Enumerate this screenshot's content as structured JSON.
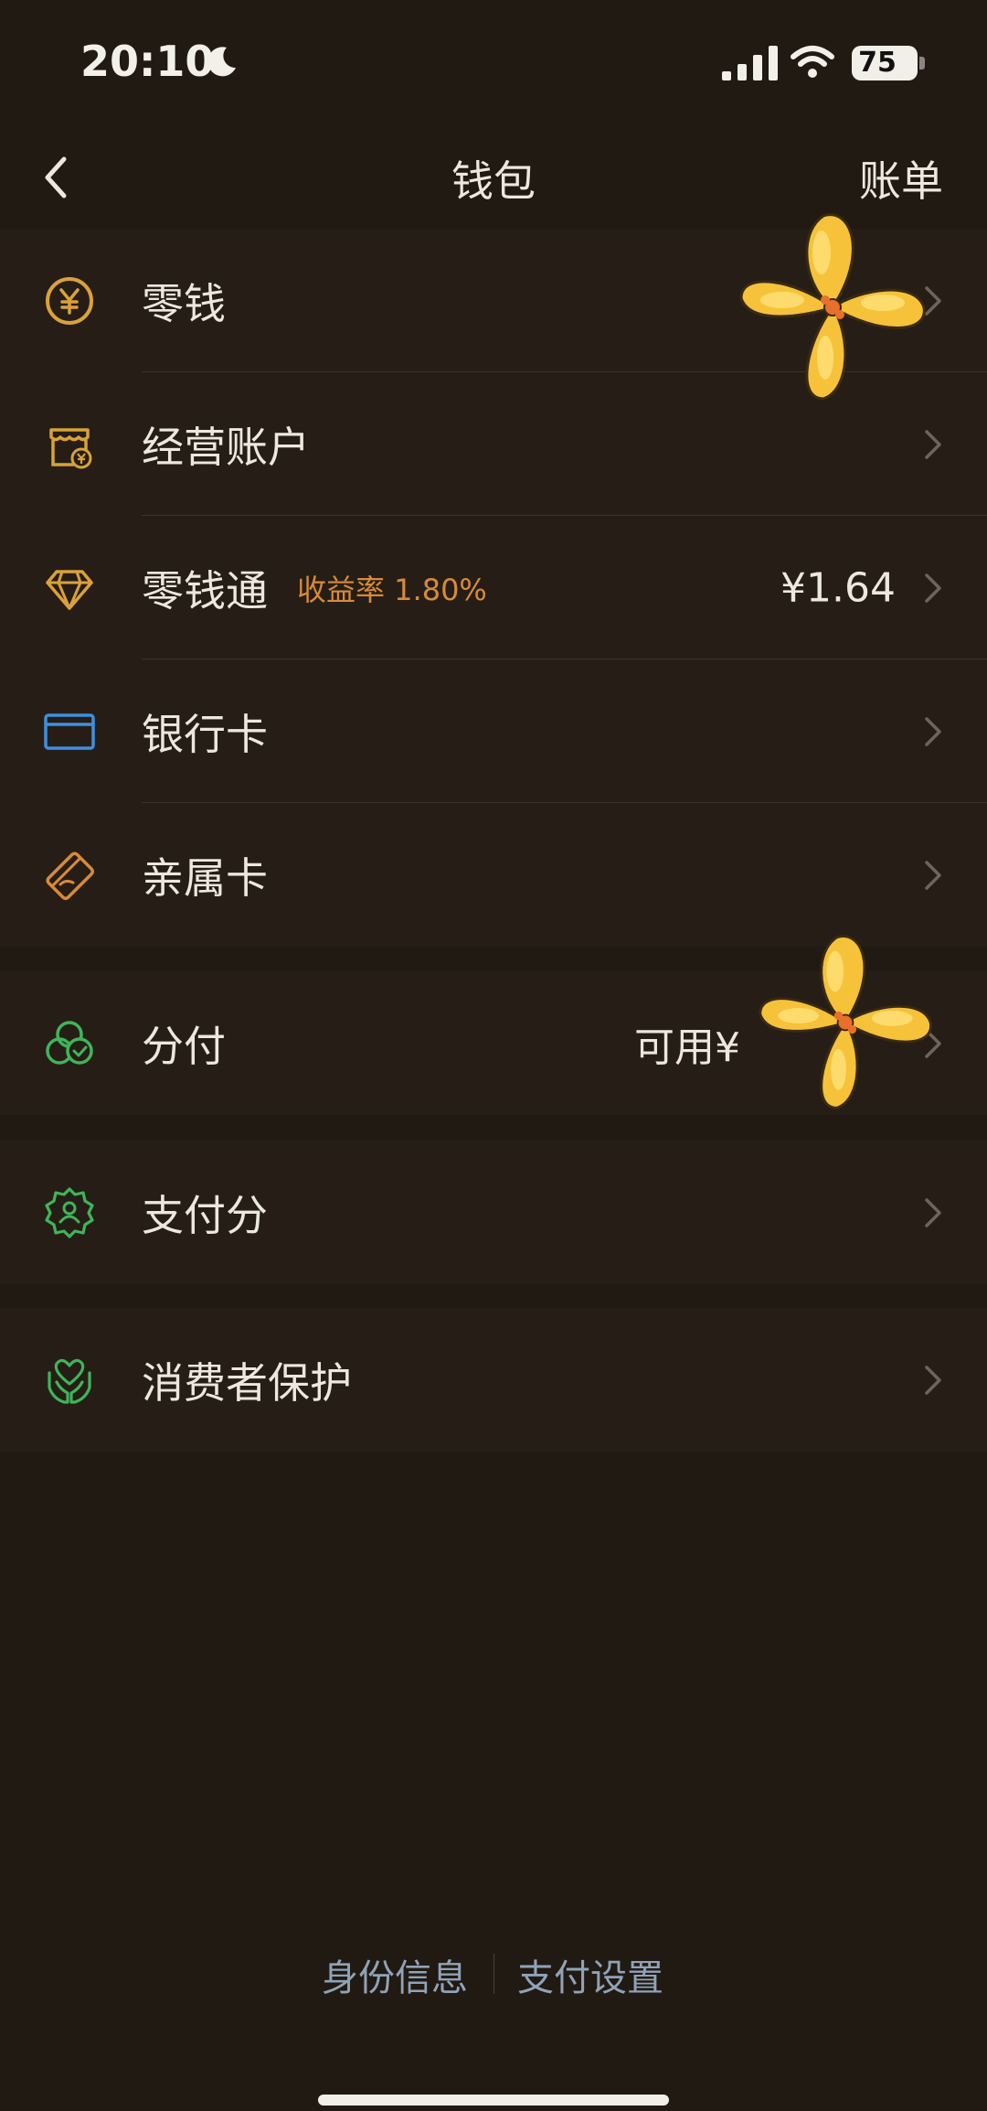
{
  "status_bar": {
    "time": "20:10",
    "battery": "75",
    "icons": [
      "moon-icon",
      "signal-icon",
      "wifi-icon",
      "battery-icon"
    ]
  },
  "nav": {
    "title": "钱包",
    "right_action": "账单",
    "back_icon": "chevron-left-icon"
  },
  "groups": [
    {
      "items": [
        {
          "label": "零钱",
          "icon": "yuan-coin-icon",
          "value": ""
        },
        {
          "label": "经营账户",
          "icon": "business-account-icon",
          "value": ""
        },
        {
          "label": "零钱通",
          "icon": "diamond-icon",
          "tag": "收益率 1.80%",
          "value": "¥1.64"
        },
        {
          "label": "银行卡",
          "icon": "bank-card-icon",
          "value": ""
        },
        {
          "label": "亲属卡",
          "icon": "family-card-icon",
          "value": ""
        }
      ]
    },
    {
      "items": [
        {
          "label": "分付",
          "icon": "fenfu-icon",
          "value": "可用¥"
        },
        {
          "label": "支付分",
          "icon": "pay-score-icon",
          "value": ""
        }
      ]
    },
    {
      "items": [
        {
          "label": "消费者保护",
          "icon": "consumer-protection-icon",
          "value": ""
        }
      ]
    }
  ],
  "footer": {
    "identity": "身份信息",
    "payment_settings": "支付设置"
  },
  "colors": {
    "background": "#211a12",
    "row_bg": "#261e16",
    "gold": "#d9a23a",
    "blue": "#3f8fe0",
    "orange": "#d88a3a",
    "green": "#3fb55a",
    "footer_link": "#8fa3b8"
  }
}
